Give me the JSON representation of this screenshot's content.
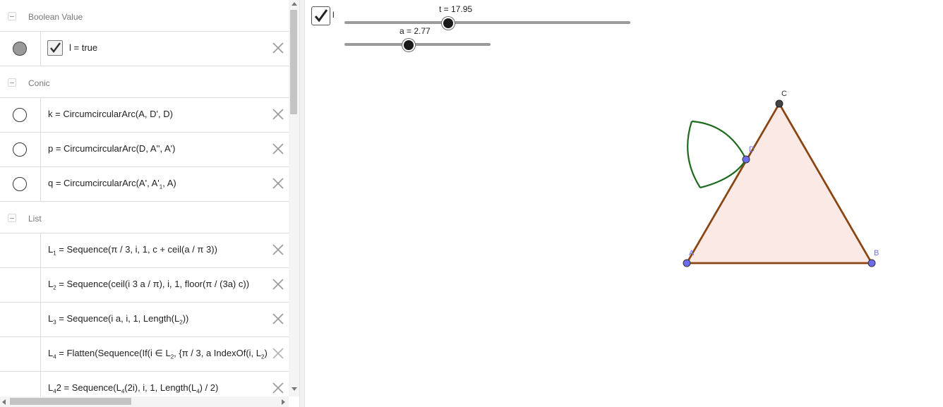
{
  "algebra": {
    "groups": [
      {
        "label": "Boolean Value"
      },
      {
        "label": "Conic"
      },
      {
        "label": "List"
      }
    ],
    "boolean_row": {
      "expression": "l = true"
    },
    "conic_rows": [
      {
        "expression": "k = CircumcircularArc(A, D', D)"
      },
      {
        "expression": "p = CircumcircularArc(D, A'', A')"
      },
      {
        "expression_pre": "q = CircumcircularArc(A', A'",
        "expression_sub": "1",
        "expression_post": ", A)"
      }
    ],
    "list_rows": [
      {
        "name": "L",
        "sub": "1",
        "rhs": " = Sequence(π / 3, i, 1, c + ceil(a / π 3))"
      },
      {
        "name": "L",
        "sub": "2",
        "rhs": " = Sequence(ceil(i 3 a / π), i, 1, floor(π / (3a) c))"
      },
      {
        "name": "L",
        "sub": "3",
        "rhs_pre": " = Sequence(i a, i, 1, Length(L",
        "rhs_sub": "2",
        "rhs_post": "))"
      },
      {
        "name": "L",
        "sub": "4",
        "rhs_pre": " = Flatten(Sequence(If(i ∈ L",
        "rhs_sub": "2",
        "rhs_post": ", {π / 3, a IndexOf(i, L",
        "rhs_sub2": "2",
        "rhs_post2": ")"
      },
      {
        "name": "L",
        "sub": "4",
        "rhs_pre": "2 = Sequence(L",
        "rhs_sub": "4",
        "rhs_post": "(2i), i, 1, Length(L",
        "rhs_sub2": "4",
        "rhs_post2": ") / 2)"
      }
    ]
  },
  "graphics": {
    "checkbox_label": "l",
    "sliders": [
      {
        "label": "t = 17.95",
        "name": "t",
        "value": 17.95
      },
      {
        "label": "a = 2.77",
        "name": "a",
        "value": 2.77
      }
    ],
    "points": {
      "A": "A",
      "B": "B",
      "C": "C",
      "D": "D"
    }
  },
  "colors": {
    "triangle_stroke": "#8b4513",
    "triangle_fill": "#fbe9e5",
    "arc": "#1e6b1e",
    "point": "#6c6cf0",
    "point_dark": "#444444"
  }
}
